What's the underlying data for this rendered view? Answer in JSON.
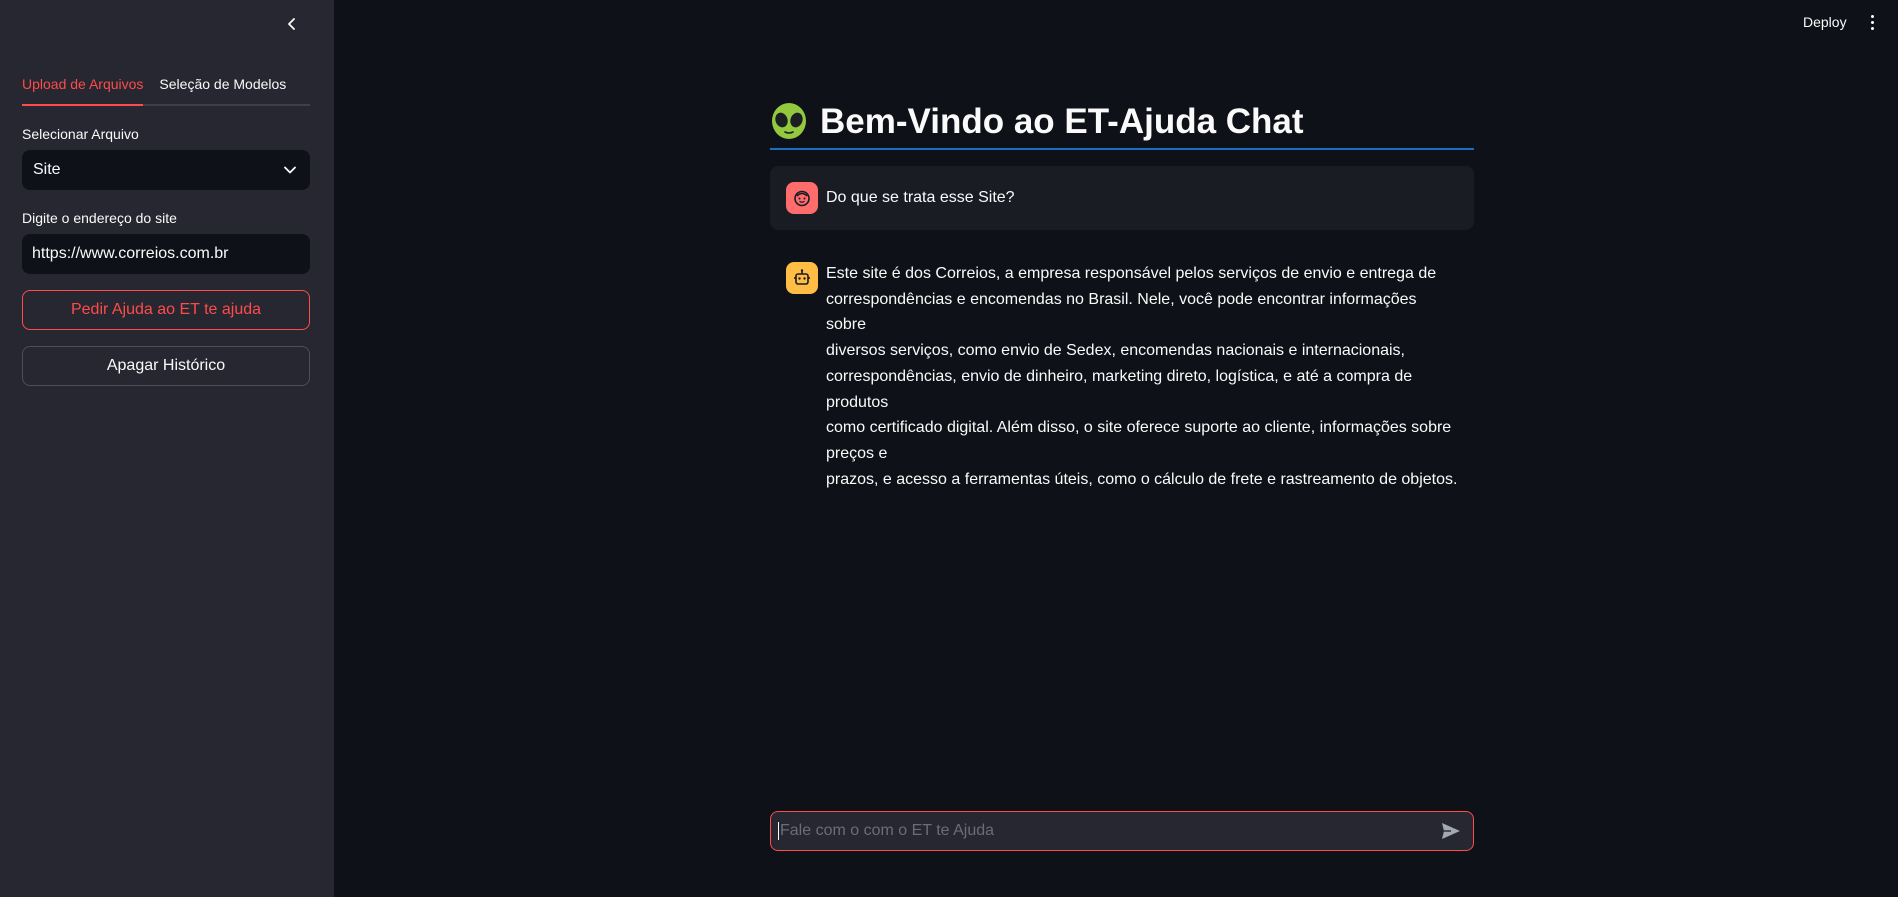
{
  "header": {
    "deploy_label": "Deploy",
    "menu_icon": "kebab-menu-icon"
  },
  "sidebar": {
    "tabs": [
      {
        "label": "Upload de Arquivos",
        "active": true
      },
      {
        "label": "Seleção de Modelos",
        "active": false
      }
    ],
    "file_select": {
      "label": "Selecionar Arquivo",
      "value": "Site"
    },
    "url_input": {
      "label": "Digite o endereço do site",
      "value": "https://www.correios.com.br"
    },
    "help_button": "Pedir Ajuda ao ET te ajuda",
    "clear_button": "Apagar Histórico"
  },
  "main": {
    "title_emoji": "👽",
    "title": "Bem-Vindo ao ET-Ajuda Chat",
    "messages": [
      {
        "role": "user",
        "avatar_icon": "user-face-icon",
        "text": "Do que se trata esse Site?"
      },
      {
        "role": "assistant",
        "avatar_icon": "robot-icon",
        "lines": [
          "Este site é dos Correios, a empresa responsável pelos serviços de envio e entrega de",
          "correspondências e encomendas no Brasil. Nele, você pode encontrar informações sobre",
          "diversos serviços, como envio de Sedex, encomendas nacionais e internacionais,",
          "correspondências, envio de dinheiro, marketing direto, logística, e até a compra de produtos",
          "como certificado digital. Além disso, o site oferece suporte ao cliente, informações sobre preços e",
          "prazos, e acesso a ferramentas úteis, como o cálculo de frete e rastreamento de objetos."
        ]
      }
    ],
    "chat_input": {
      "placeholder": "Fale com o com o ET te Ajuda"
    }
  },
  "colors": {
    "accent": "#ff4b4b",
    "background": "#0e1117",
    "sidebar": "#262730",
    "title_underline": "#1c6ec2",
    "user_avatar": "#ff6c6c",
    "bot_avatar": "#ffbd45"
  }
}
